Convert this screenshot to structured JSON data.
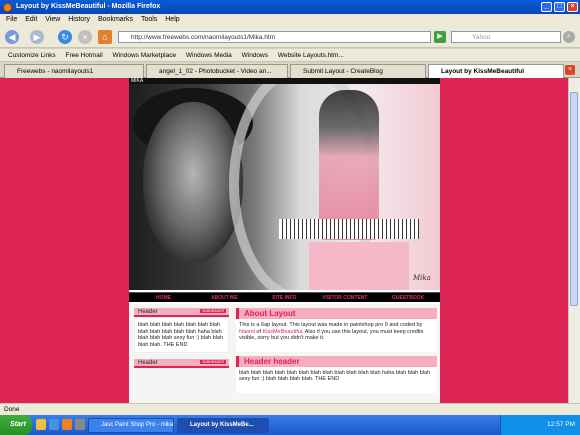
{
  "window": {
    "title": "Layout by KissMeBeautiful - Mozilla Firefox"
  },
  "menu": [
    "File",
    "Edit",
    "View",
    "History",
    "Bookmarks",
    "Tools",
    "Help"
  ],
  "nav": {
    "url": "http://www.freewebs.com/naomilayouts1/Mika.htm",
    "search_placeholder": "Yahoo"
  },
  "bookmarks": [
    "Customize Links",
    "Free Hotmail",
    "Windows Marketplace",
    "Windows Media",
    "Windows",
    "Website Layouts.htm..."
  ],
  "tabs": [
    {
      "label": "Freewebs - naomilayouts1"
    },
    {
      "label": "angel_1_02 - Photobucket - Video an..."
    },
    {
      "label": "Submit Layout - CreateBlog"
    },
    {
      "label": "Layout by KissMeBeautiful"
    }
  ],
  "site": {
    "banner_caption": "MIKA",
    "banner_signature": "Mika",
    "navlinks": [
      "HOME",
      "ABOUT ME",
      "SITE INFO",
      "VISITOR CONTENT",
      "GUESTBOOK"
    ],
    "sidebar": [
      {
        "header": "Header",
        "sub": "SUBHEADER",
        "text": "blah blah blah blah blah blah blah blah blah blah blah blah haha blah blah blah blah sexy fun :) blah blah blah blah. THE END"
      },
      {
        "header": "Header",
        "sub": "SUBHEADER"
      }
    ],
    "main": [
      {
        "title": "About Layout",
        "text_before": "This is a 6ap layout. This layout was made in paintshop pro 9 and coded by ",
        "text_author1": "Naomi",
        "text_mid": " of ",
        "text_author2": "KissMeBeautiful",
        "text_after": ". Also if you use this layout, you must keep credits visible, sorry but you didn't make it."
      },
      {
        "title": "Header header",
        "text": "blah blah blah blah blah blah blah blah blah blah blah blah haha blah blah blah sexy fun :) blah blah blah blah. THE END"
      }
    ]
  },
  "status": "Done",
  "taskbar": {
    "start": "Start",
    "tasks": [
      {
        "label": "Jasc Paint Shop Pro - mika1"
      },
      {
        "label": "Layout by KissMeBe..."
      }
    ],
    "clock": "12:57 PM"
  },
  "colors": {
    "accent": "#dc2554",
    "header_pink": "#f4aec0",
    "titlebar": "#0a5cd8"
  }
}
